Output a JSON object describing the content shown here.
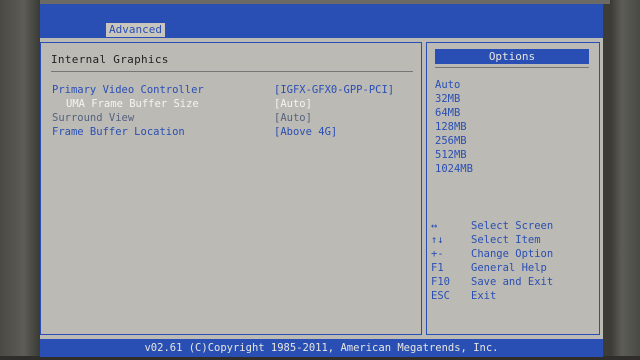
{
  "header": {
    "tab_label": "Advanced"
  },
  "main": {
    "section_title": "Internal Graphics",
    "settings": [
      {
        "label": "Primary Video Controller",
        "value": "[IGFX-GFX0-GPP-PCI]"
      },
      {
        "label": "UMA Frame Buffer Size",
        "value": "[Auto]"
      },
      {
        "label": "Surround View",
        "value": "[Auto]"
      },
      {
        "label": "Frame Buffer Location",
        "value": "[Above 4G]"
      }
    ]
  },
  "options_panel": {
    "title": "Options",
    "items": [
      "Auto",
      "32MB",
      "64MB",
      "128MB",
      "256MB",
      "512MB",
      "1024MB"
    ]
  },
  "help": [
    {
      "key": "↔",
      "desc": "Select Screen"
    },
    {
      "key": "↑↓",
      "desc": "Select Item"
    },
    {
      "key": "+-",
      "desc": "Change Option"
    },
    {
      "key": "F1",
      "desc": "General Help"
    },
    {
      "key": "F10",
      "desc": "Save and Exit"
    },
    {
      "key": "ESC",
      "desc": "Exit"
    }
  ],
  "footer": {
    "copyright": "v02.61 (C)Copyright 1985-2011, American Megatrends, Inc."
  },
  "colors": {
    "bios_blue": "#2a4fb4",
    "background": "#bcbab5",
    "highlight_text": "#f5f5f0"
  }
}
